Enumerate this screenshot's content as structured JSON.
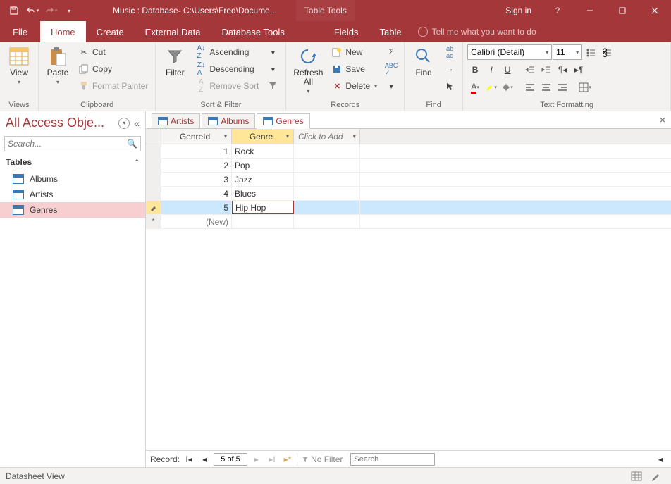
{
  "titlebar": {
    "title": "Music : Database- C:\\Users\\Fred\\Docume...",
    "context": "Table Tools",
    "signin": "Sign in"
  },
  "menu": {
    "file": "File",
    "items": [
      "Home",
      "Create",
      "External Data",
      "Database Tools"
    ],
    "ctx": [
      "Fields",
      "Table"
    ],
    "active": "Home",
    "tellme": "Tell me what you want to do"
  },
  "ribbon": {
    "views": {
      "label": "Views",
      "view": "View"
    },
    "clipboard": {
      "label": "Clipboard",
      "paste": "Paste",
      "cut": "Cut",
      "copy": "Copy",
      "format_painter": "Format Painter"
    },
    "sortfilter": {
      "label": "Sort & Filter",
      "filter": "Filter",
      "asc": "Ascending",
      "desc": "Descending",
      "remove": "Remove Sort"
    },
    "records": {
      "label": "Records",
      "refresh": "Refresh\nAll",
      "new": "New",
      "save": "Save",
      "delete": "Delete"
    },
    "find": {
      "label": "Find",
      "find": "Find"
    },
    "textfmt": {
      "label": "Text Formatting",
      "font": "Calibri (Detail)",
      "size": "11"
    }
  },
  "nav": {
    "title": "All Access Obje...",
    "search_ph": "Search...",
    "group": "Tables",
    "items": [
      "Albums",
      "Artists",
      "Genres"
    ],
    "selected": "Genres"
  },
  "doctabs": {
    "tabs": [
      "Artists",
      "Albums",
      "Genres"
    ],
    "active": "Genres"
  },
  "grid": {
    "columns": [
      {
        "name": "GenreId",
        "w": 100
      },
      {
        "name": "Genre",
        "w": 88,
        "active": true
      }
    ],
    "addcol": "Click to Add",
    "rows": [
      {
        "id": "1",
        "val": "Rock"
      },
      {
        "id": "2",
        "val": "Pop"
      },
      {
        "id": "3",
        "val": "Jazz"
      },
      {
        "id": "4",
        "val": "Blues"
      },
      {
        "id": "5",
        "val": "Hip Hop",
        "editing": true,
        "selected": true
      }
    ],
    "newrow": "(New)"
  },
  "recnav": {
    "label": "Record:",
    "pos": "5 of 5",
    "nofilter": "No Filter",
    "search": "Search"
  },
  "status": {
    "view": "Datasheet View"
  }
}
